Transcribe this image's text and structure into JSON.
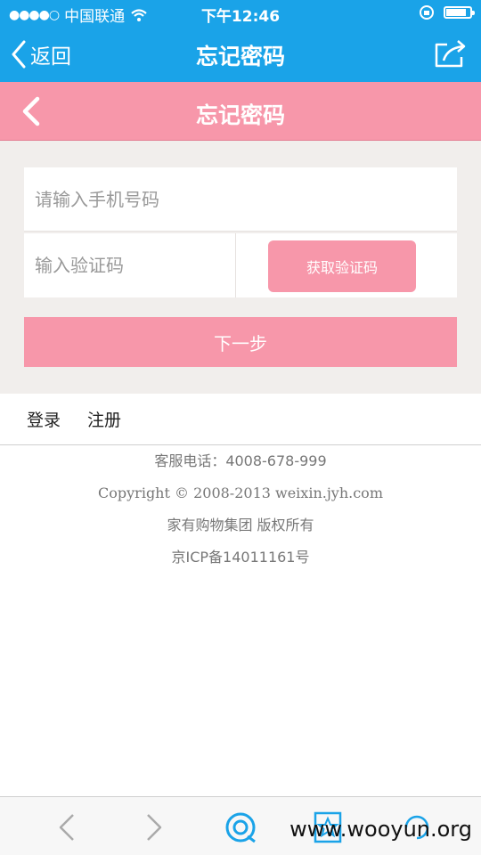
{
  "status_bar": {
    "carrier": "中国联通",
    "time": "下午12:46"
  },
  "app_nav": {
    "back_label": "返回",
    "title": "忘记密码",
    "share_icon": "share-icon"
  },
  "page_header": {
    "title": "忘记密码",
    "back_icon": "chevron-left-icon"
  },
  "form": {
    "phone_placeholder": "请输入手机号码",
    "code_placeholder": "输入验证码",
    "get_code_label": "获取验证码",
    "next_label": "下一步"
  },
  "links": {
    "login": "登录",
    "register": "注册"
  },
  "footer": {
    "service_phone": "客服电话：4008-678-999",
    "copyright": "Copyright © 2008-2013 weixin.jyh.com",
    "rights": "家有购物集团 版权所有",
    "icp": "京ICP备14011161号"
  },
  "toolbar": {
    "watermark": "www.wooyun.org"
  },
  "colors": {
    "nav_blue": "#1aa3e8",
    "brand_pink": "#f797aa",
    "form_bg": "#f1eeec"
  }
}
